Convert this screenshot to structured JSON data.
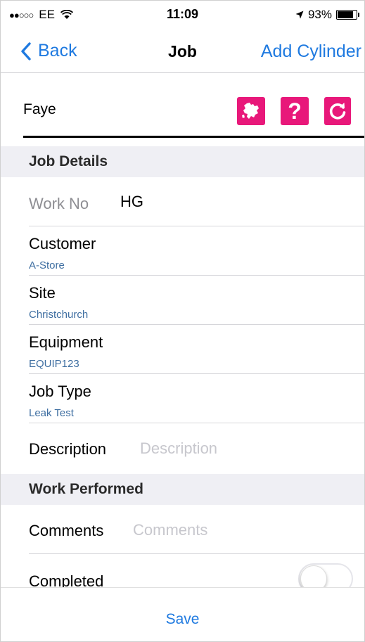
{
  "status_bar": {
    "carrier": "EE",
    "signal": "●●○○○",
    "time": "11:09",
    "battery_percent": "93%",
    "battery_level": 0.93
  },
  "nav": {
    "back_label": "Back",
    "title": "Job",
    "add_cylinder_label": "Add Cylinder"
  },
  "engineer": {
    "name": "Faye",
    "buttons": [
      "map-icon",
      "help-icon",
      "refresh-icon"
    ],
    "help_glyph": "?"
  },
  "sections": {
    "job_details": "Job Details",
    "work_performed": "Work Performed"
  },
  "work_no": {
    "label": "Work No",
    "value": "HG"
  },
  "customer": {
    "label": "Customer",
    "value": "A-Store"
  },
  "site": {
    "label": "Site",
    "value": "Christchurch"
  },
  "equipment": {
    "label": "Equipment",
    "value": "EQUIP123"
  },
  "job_type": {
    "label": "Job Type",
    "value": "Leak Test"
  },
  "description": {
    "label": "Description",
    "value": "",
    "placeholder": "Description"
  },
  "comments": {
    "label": "Comments",
    "value": "",
    "placeholder": "Comments"
  },
  "completed": {
    "label": "Completed",
    "on": false
  },
  "save_label": "Save",
  "colors": {
    "accent": "#1f7ae0",
    "pink": "#e8187a",
    "sub_value": "#3e6ea1",
    "section_bg": "#efeff4"
  }
}
